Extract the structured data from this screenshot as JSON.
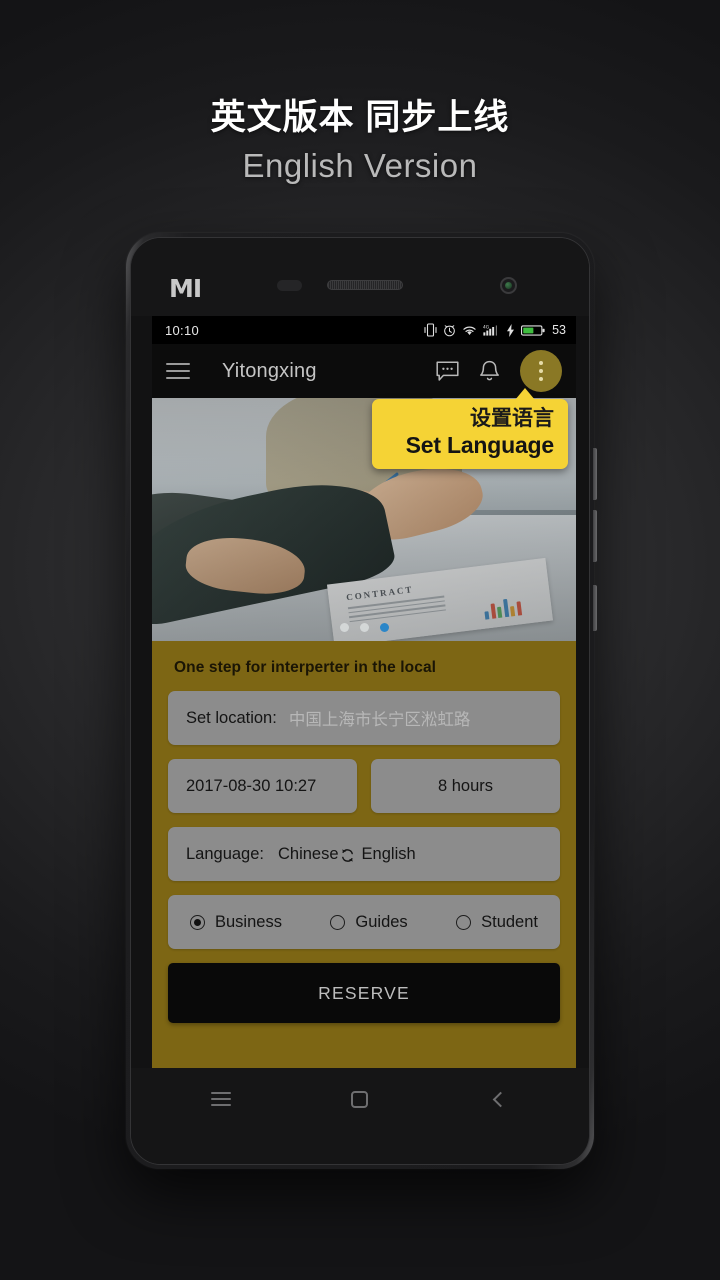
{
  "promo": {
    "headline_cn": "英文版本 同步上线",
    "headline_en": "English Version"
  },
  "device": {
    "brand_logo": "MI",
    "icons": {
      "proximity_sensor": "proximity-sensor",
      "earpiece": "earpiece-speaker",
      "front_camera": "front-camera"
    }
  },
  "statusbar": {
    "time": "10:10",
    "battery_percent": "53",
    "icons": [
      "vibrate-icon",
      "alarm-icon",
      "wifi-icon",
      "signal-4g-icon",
      "charging-bolt-icon",
      "battery-icon"
    ]
  },
  "appbar": {
    "menu_icon": "hamburger-menu-icon",
    "title": "Yitongxing",
    "chat_icon": "chat-bubble-icon",
    "bell_icon": "notification-bell-icon",
    "overflow_icon": "overflow-menu-icon"
  },
  "tooltip": {
    "text_cn": "设置语言",
    "text_en": "Set Language",
    "bg_color": "#f5d335"
  },
  "banner": {
    "alt": "business-handshake-contract-photo",
    "document_title": "CONTRACT",
    "dots": [
      {
        "active": false
      },
      {
        "active": false
      },
      {
        "active": true
      }
    ],
    "active_dot_color": "#2b86c8"
  },
  "form": {
    "panel_color": "#7d6614",
    "heading": "One step for interperter in the local",
    "location": {
      "label": "Set location:",
      "placeholder": "中国上海市长宁区淞虹路",
      "value": ""
    },
    "datetime": {
      "value": "2017-08-30 10:27"
    },
    "duration": {
      "value": "8 hours"
    },
    "language": {
      "label": "Language:",
      "from": "Chinese",
      "swap_icon": "swap-arrows-icon",
      "to": "English"
    },
    "radios": [
      {
        "label": "Business",
        "checked": true
      },
      {
        "label": "Guides",
        "checked": false
      },
      {
        "label": "Student",
        "checked": false
      }
    ],
    "submit_label": "RESERVE"
  },
  "navbar": {
    "menu_icon": "android-menu-icon",
    "home_icon": "android-home-icon",
    "back_icon": "android-back-icon"
  }
}
